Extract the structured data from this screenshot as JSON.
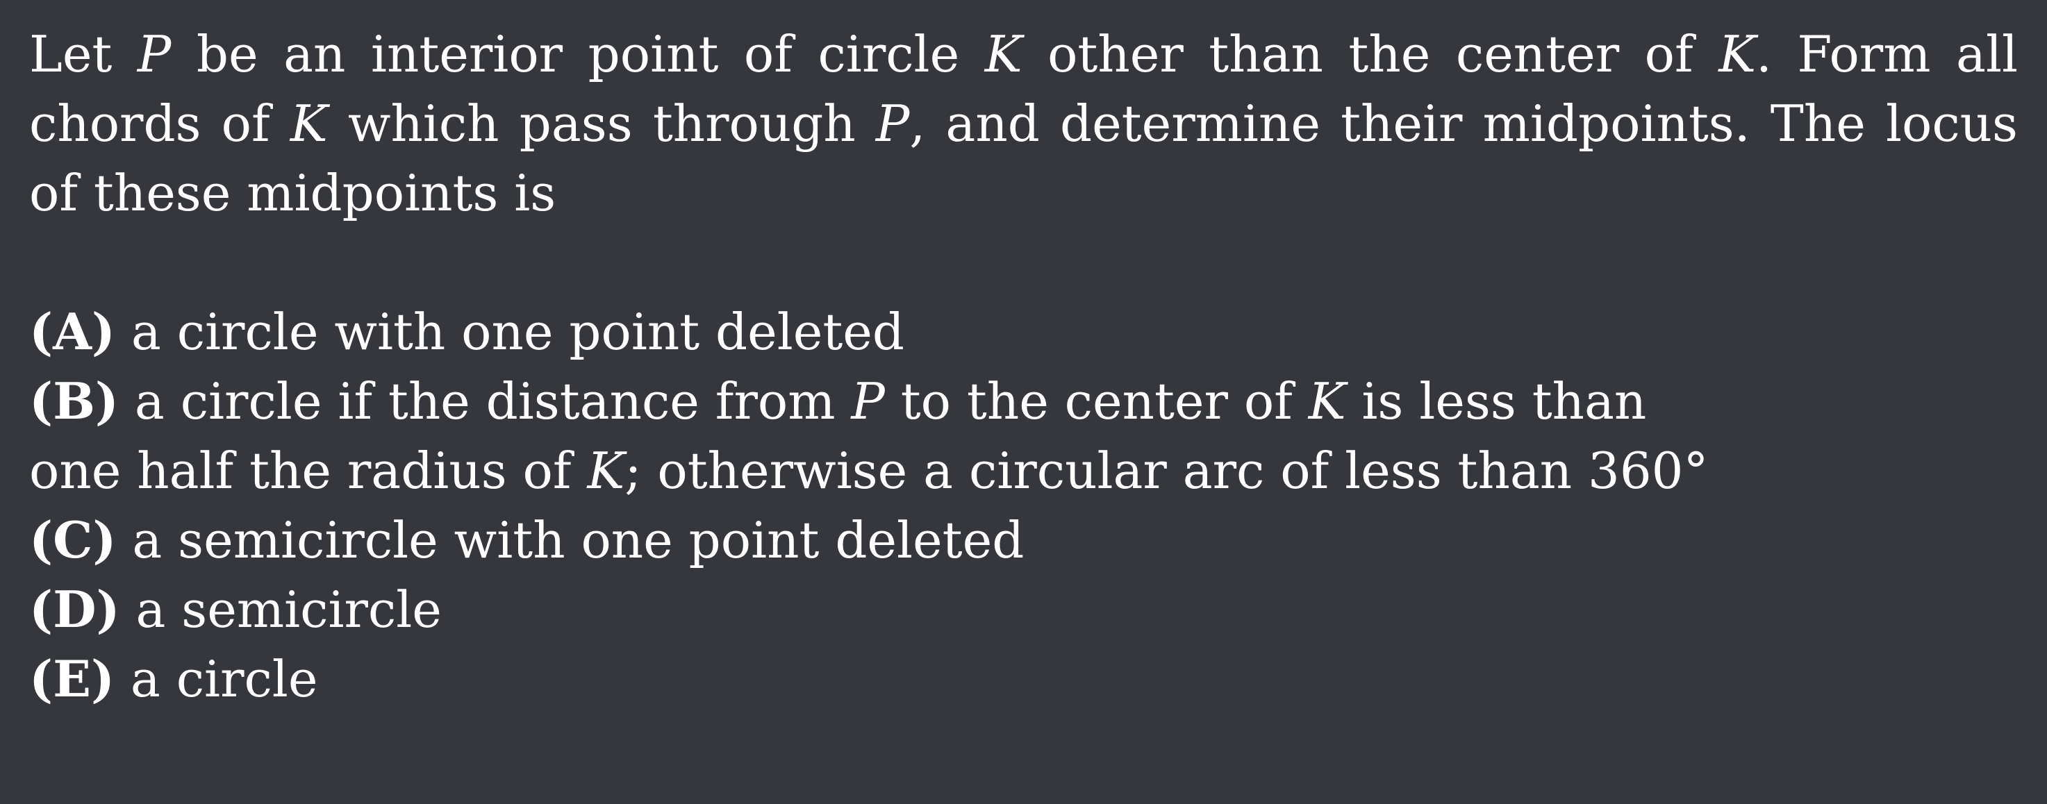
{
  "problem": {
    "segments": [
      "Let ",
      "P",
      " be an interior point of circle ",
      "K",
      " other than the center of ",
      "K",
      ". Form all chords of ",
      "K",
      " which pass through ",
      "P",
      ", and determine their midpoints. The locus of these midpoints is"
    ]
  },
  "choices": [
    {
      "label": "(A)",
      "segments": [
        " a circle with one point deleted"
      ]
    },
    {
      "label": "(B)",
      "segments": [
        " a circle if the distance from ",
        "P",
        " to the center of ",
        "K",
        " is less than one half the radius of ",
        "K",
        "; otherwise a circular arc of less than 360°"
      ]
    },
    {
      "label": "(C)",
      "segments": [
        " a semicircle with one point deleted"
      ]
    },
    {
      "label": "(D)",
      "segments": [
        " a semicircle"
      ]
    },
    {
      "label": "(E)",
      "segments": [
        " a circle"
      ]
    }
  ]
}
